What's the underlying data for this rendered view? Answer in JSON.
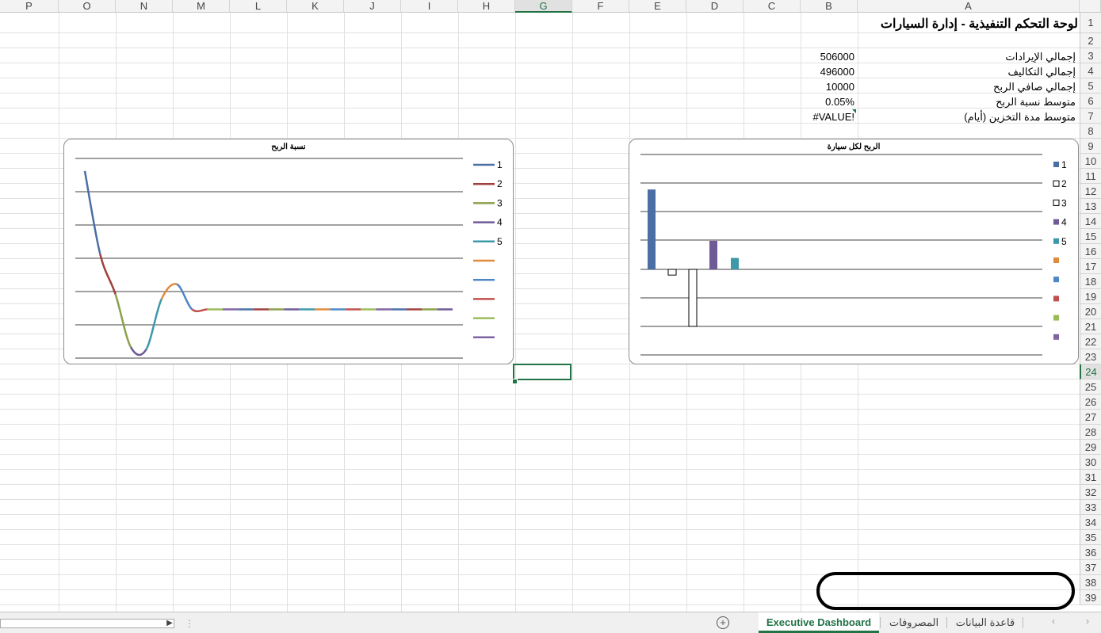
{
  "columns": [
    "A",
    "B",
    "C",
    "D",
    "E",
    "F",
    "G",
    "H",
    "I",
    "J",
    "K",
    "L",
    "M",
    "N",
    "O",
    "P"
  ],
  "rows": [
    "1",
    "2",
    "3",
    "4",
    "5",
    "6",
    "7",
    "8",
    "9",
    "10",
    "11",
    "12",
    "13",
    "14",
    "15",
    "16",
    "17",
    "18",
    "19",
    "20",
    "21",
    "22",
    "23",
    "24",
    "25",
    "26",
    "27",
    "28",
    "29",
    "30",
    "31",
    "32",
    "33",
    "34",
    "35",
    "36",
    "37",
    "38",
    "39"
  ],
  "selected_column": "G",
  "selected_row": "24",
  "sheet": {
    "title": "لوحة التحكم التنفيذية - إدارة السيارات",
    "kpis": [
      {
        "label": "إجمالي الإيرادات",
        "value": "506000"
      },
      {
        "label": "إجمالي التكاليف",
        "value": "496000"
      },
      {
        "label": "إجمالي صافي الربح",
        "value": "10000"
      },
      {
        "label": "متوسط نسبة الربح",
        "value": "0.05%"
      },
      {
        "label": "متوسط مدة التخزين (أيام)",
        "value": "#VALUE!"
      }
    ]
  },
  "chart_data": [
    {
      "type": "line",
      "title": "نسبة الربح",
      "legend_position": "right",
      "grid": true,
      "legend": [
        "1",
        "2",
        "3",
        "4",
        "5",
        "",
        "",
        "",
        "",
        ""
      ],
      "series_colors": [
        "#4a6fa5",
        "#a0403d",
        "#8aa04a",
        "#6e5a95",
        "#3d98aa",
        "#e08a3c",
        "#4f87c5",
        "#c0504d",
        "#9bbb59",
        "#8064a2"
      ],
      "ylim": [
        -2,
        6
      ],
      "values": [
        5.5,
        2.2,
        0.6,
        -1.5,
        -1.6,
        0.4,
        1.0,
        0.0,
        0,
        0,
        0,
        0,
        0,
        0,
        0,
        0,
        0,
        0,
        0,
        0,
        0,
        0,
        0,
        0,
        0
      ]
    },
    {
      "type": "bar",
      "title": "الربح لكل سيارة",
      "legend_position": "right",
      "grid": true,
      "legend": [
        "1",
        "2",
        "3",
        "4",
        "5",
        "",
        "",
        "",
        "",
        ""
      ],
      "series_colors": [
        "#4a6fa5",
        "#ffffff",
        "#ffffff",
        "#6e5a95",
        "#3d98aa",
        "#e08a3c",
        "#4f87c5",
        "#c0504d",
        "#9bbb59",
        "#8064a2"
      ],
      "ylim": [
        -3,
        4
      ],
      "values": [
        2.8,
        -0.2,
        -2.0,
        1.0,
        0.4,
        0,
        0,
        0,
        0,
        0
      ]
    }
  ],
  "tabs": [
    "قاعدة البيانات",
    "المصروفات",
    "Executive Dashboard"
  ],
  "active_tab": "Executive Dashboard",
  "icons": {
    "add_sheet": "plus-circle-icon",
    "scroll_left": "chevron-left-icon",
    "scroll_right": "chevron-right-icon"
  }
}
